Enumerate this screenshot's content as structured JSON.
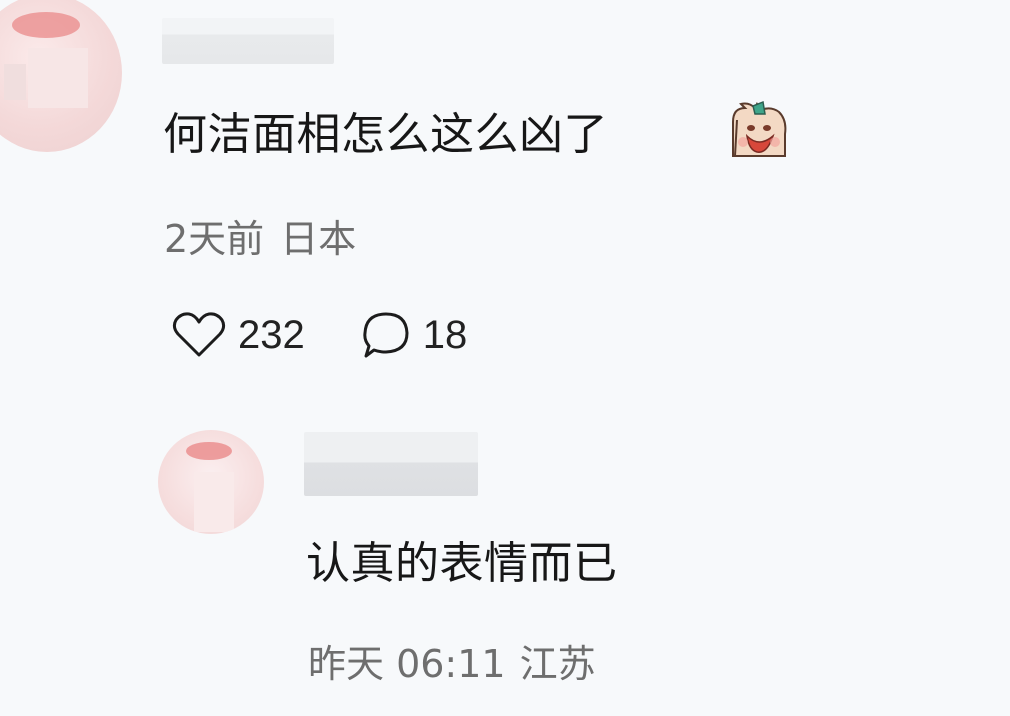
{
  "comment": {
    "text": "何洁面相怎么这么凶了",
    "sticker_icon": "cartoon-sticker-icon",
    "time": "2天前",
    "location": "日本",
    "likes": "232",
    "replies_count": "18",
    "like_icon": "heart-icon",
    "reply_icon": "comment-bubble-icon"
  },
  "reply": {
    "text": "认真的表情而已",
    "time": "昨天 06:11",
    "location": "江苏"
  },
  "colors": {
    "background": "#f7f9fb",
    "text": "#171717",
    "meta": "#6e6e6e"
  }
}
